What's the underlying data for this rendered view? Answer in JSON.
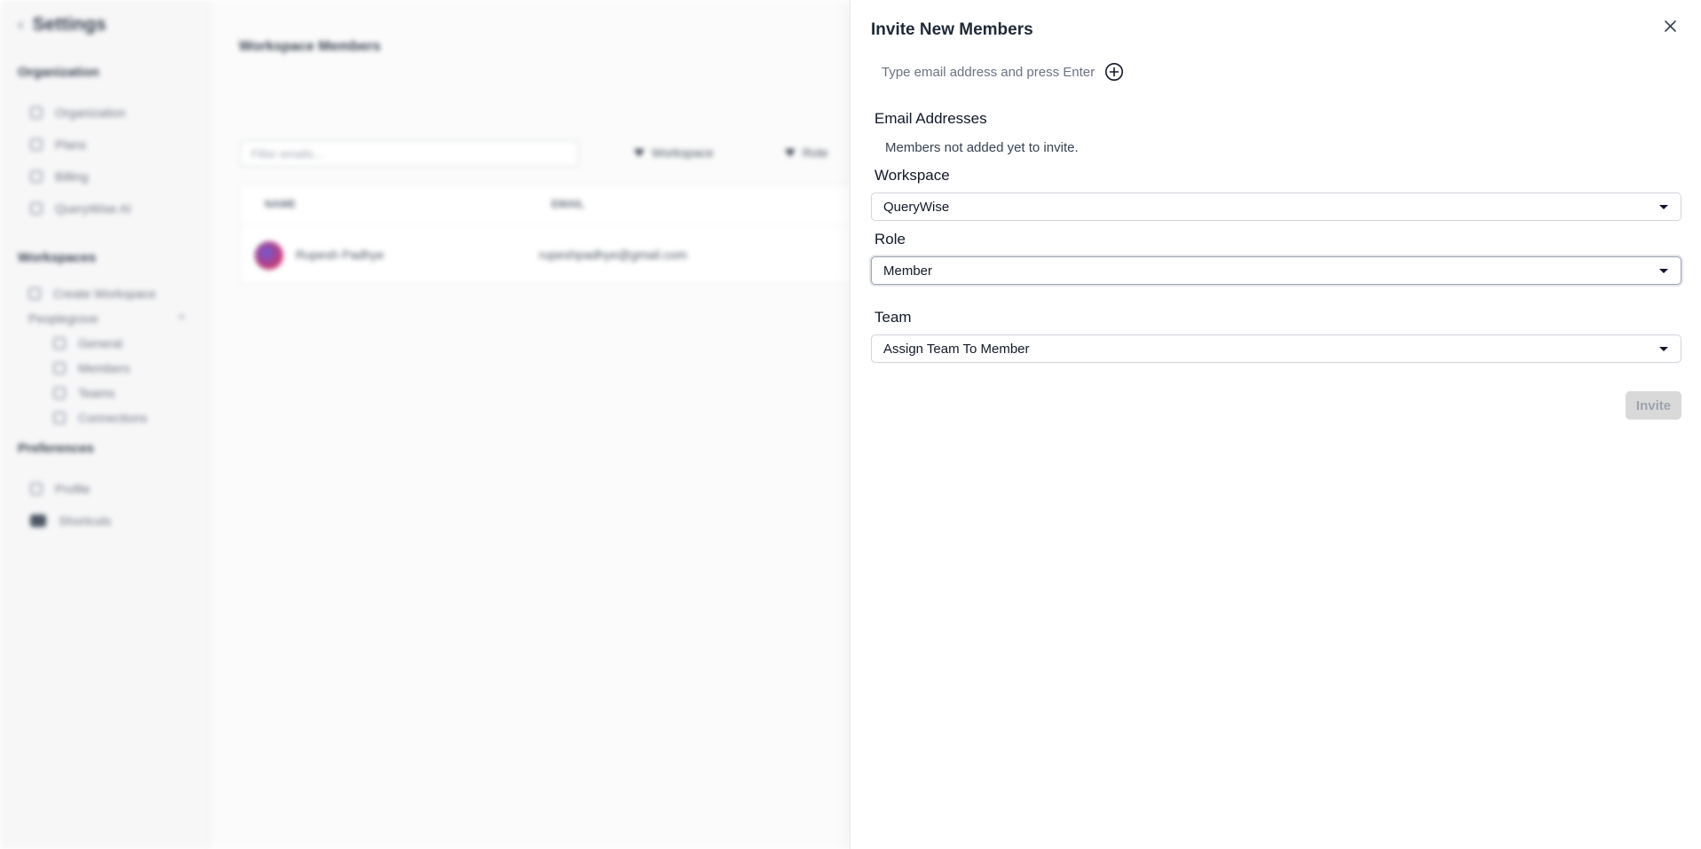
{
  "background": {
    "sidebar": {
      "title": "Settings",
      "sections": {
        "organization": "Organization",
        "workspaces": "Workspaces",
        "preferences": "Preferences"
      },
      "org_items": [
        "Organization",
        "Plans",
        "Billing",
        "QueryWise AI"
      ],
      "create_workspace": "Create Workspace",
      "workspace_name": "Peoplegrove",
      "workspace_items": [
        "General",
        "Members",
        "Teams",
        "Connections"
      ],
      "pref_items": [
        "Profile",
        "Shortcuts"
      ]
    },
    "main": {
      "title": "Workspace Members",
      "filter_placeholder": "Filter emails...",
      "filters": [
        "Workspace",
        "Role"
      ],
      "columns": [
        "NAME",
        "EMAIL"
      ],
      "row": {
        "name": "Rupesh Padhye",
        "email": "rupeshpadhye@gmail.com"
      }
    }
  },
  "drawer": {
    "title": "Invite New Members",
    "email_placeholder": "Type email address and press Enter",
    "email_label": "Email Addresses",
    "empty_note": "Members not added yet to invite.",
    "workspace_label": "Workspace",
    "workspace_value": "QueryWise",
    "role_label": "Role",
    "role_value": "Member",
    "team_label": "Team",
    "team_value": "Assign Team To Member",
    "invite_label": "Invite"
  },
  "icons": {
    "close": "close-icon",
    "add": "plus-circle-icon",
    "caret": "caret-down-icon"
  }
}
